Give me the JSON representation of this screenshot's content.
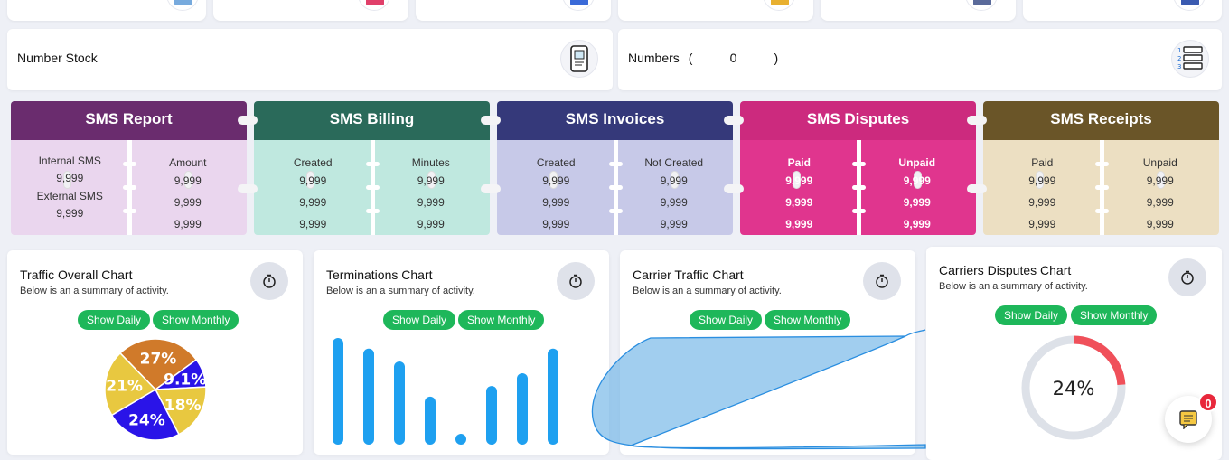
{
  "number_stock": {
    "label": "Number Stock"
  },
  "numbers": {
    "label": "Numbers",
    "open": "(",
    "value": "0",
    "close": ")"
  },
  "sms_cards": [
    {
      "title": "SMS Report",
      "color": "#6a2c6e",
      "body": "#ead6ee",
      "left_header": "Internal SMS",
      "left_values": [
        "9,999"
      ],
      "left_header2": "External SMS",
      "left_values2": [
        "9,999"
      ],
      "right_header": "Amount",
      "right_values": [
        "9,999",
        "9,999",
        "9,999"
      ]
    },
    {
      "title": "SMS Billing",
      "color": "#2a6a5a",
      "body": "#bfe8df",
      "left_header": "Created",
      "left_values": [
        "9,999",
        "9,999",
        "9,999"
      ],
      "right_header": "Minutes",
      "right_values": [
        "9,999",
        "9,999",
        "9,999"
      ]
    },
    {
      "title": "SMS Invoices",
      "color": "#35397a",
      "body": "#c7c9e8",
      "left_header": "Created",
      "left_values": [
        "9,999",
        "9,999",
        "9,999"
      ],
      "right_header": "Not Created",
      "right_values": [
        "9,999",
        "9,999",
        "9,999"
      ]
    },
    {
      "title": "SMS Disputes",
      "color": "#cc2a7e",
      "body": "#e0358e",
      "left_header": "Paid",
      "left_values": [
        "9,999",
        "9,999",
        "9,999"
      ],
      "right_header": "Unpaid",
      "right_values": [
        "9,999",
        "9,999",
        "9,999"
      ]
    },
    {
      "title": "SMS Receipts",
      "color": "#6a5528",
      "body": "#ecdfc2",
      "left_header": "Paid",
      "left_values": [
        "9,999",
        "9,999",
        "9,999"
      ],
      "right_header": "Unpaid",
      "right_values": [
        "9,999",
        "9,999",
        "9,999"
      ]
    }
  ],
  "charts": [
    {
      "title": "Traffic Overall Chart",
      "subtitle": "Below is an a summary of activity.",
      "daily": "Show Daily",
      "monthly": "Show Monthly"
    },
    {
      "title": "Terminations Chart",
      "subtitle": "Below is an a summary of activity.",
      "daily": "Show Daily",
      "monthly": "Show Monthly"
    },
    {
      "title": "Carrier Traffic Chart",
      "subtitle": "Below is an a summary of activity.",
      "daily": "Show Daily",
      "monthly": "Show Monthly"
    },
    {
      "title": "Carriers Disputes Chart",
      "subtitle": "Below is an a summary of activity.",
      "daily": "Show Daily",
      "monthly": "Show Monthly"
    }
  ],
  "chart_data": [
    {
      "type": "pie",
      "values": [
        27,
        9.1,
        18,
        24,
        21
      ],
      "labels": [
        "27%",
        "9.1%",
        "18%",
        "24%",
        "21%"
      ],
      "colors": [
        "#d07a2a",
        "#2a14e8",
        "#e8c840",
        "#2a14e8",
        "#e8c840"
      ]
    },
    {
      "type": "bar",
      "values": [
        100,
        90,
        78,
        45,
        0,
        55,
        67,
        90
      ],
      "ylim": [
        0,
        100
      ],
      "color": "#1ea0f0"
    },
    {
      "type": "area",
      "color": "#3aa0e8"
    },
    {
      "type": "pie",
      "values": [
        24,
        76
      ],
      "labels": [
        "24%"
      ],
      "colors": [
        "#f0505a",
        "#dde1e8"
      ]
    }
  ],
  "notifications": {
    "count": "0"
  }
}
